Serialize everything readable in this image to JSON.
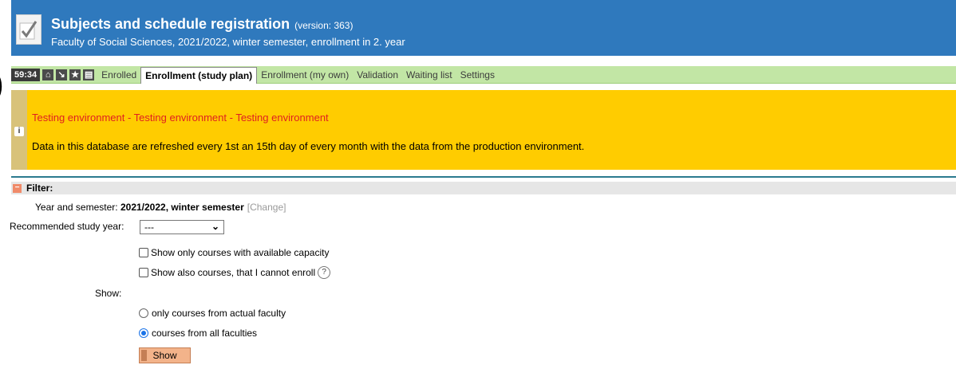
{
  "header": {
    "title": "Subjects and schedule registration",
    "version": "(version: 363)",
    "subtitle": "Faculty of Social Sciences, 2021/2022, winter semester, enrollment in 2. year"
  },
  "toolbar": {
    "timer": "59:34",
    "icons": [
      "home-icon",
      "download-icon",
      "star-icon",
      "print-icon"
    ]
  },
  "tabs": [
    {
      "label": "Enrolled",
      "active": false
    },
    {
      "label": "Enrollment (study plan)",
      "active": true
    },
    {
      "label": "Enrollment (my own)",
      "active": false
    },
    {
      "label": "Validation",
      "active": false
    },
    {
      "label": "Waiting list",
      "active": false
    },
    {
      "label": "Settings",
      "active": false
    }
  ],
  "banner": {
    "warning": "Testing environment - Testing environment - Testing environment",
    "text": "Data in this database are refreshed every 1st an 15th day of every month with the data from the production environment."
  },
  "filter": {
    "title": "Filter:",
    "year_label": "Year and semester:",
    "year_value": "2021/2022, winter semester",
    "change_link": "[Change]",
    "rec_year_label": "Recommended study year:",
    "rec_year_value": "---",
    "cb_capacity": "Show only courses with available capacity",
    "cb_cannot_enroll": "Show also courses, that I cannot enroll",
    "show_label": "Show:",
    "radio_actual": "only courses from actual faculty",
    "radio_all": "courses from all faculties",
    "show_button": "Show"
  },
  "colors": {
    "header_blue": "#2f79bd",
    "tabs_green": "#c2e6a5",
    "banner_yellow": "#ffcc00",
    "warning_red": "#e02020",
    "button_orange": "#f3b38a"
  }
}
